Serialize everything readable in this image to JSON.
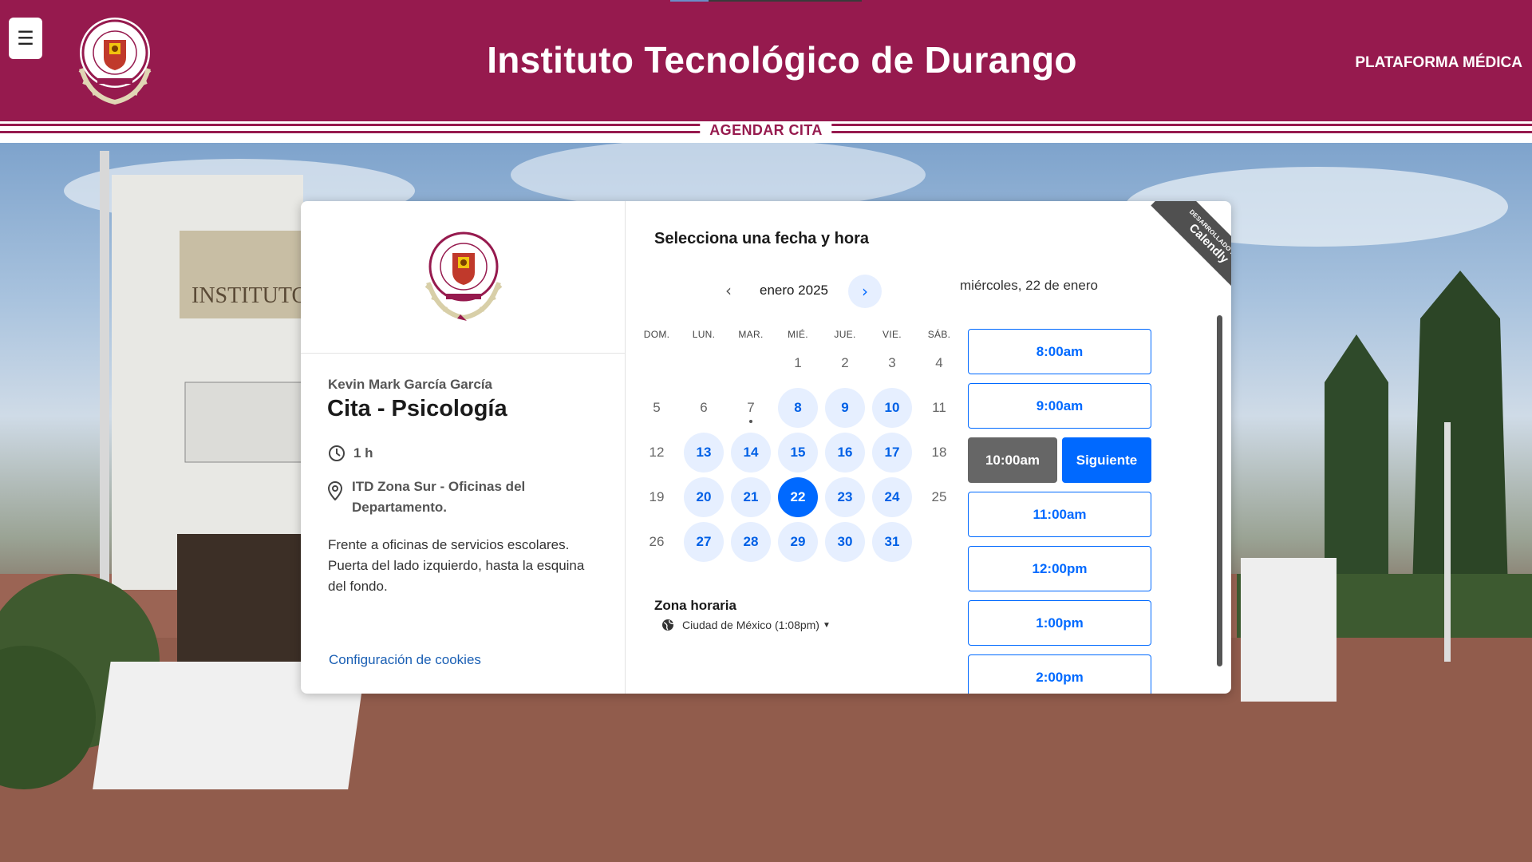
{
  "header": {
    "menu_icon": "☰",
    "title": "Instituto Tecnológico de Durango",
    "platform": "PLATAFORMA MÉDICA"
  },
  "section": {
    "title": "AGENDAR CITA"
  },
  "event": {
    "host": "Kevin Mark García García",
    "title": "Cita - Psicología",
    "duration": "1 h",
    "location": "ITD Zona Sur - Oficinas del Departamento.",
    "description": "Frente a oficinas de servicios escolares. Puerta del lado izquierdo, hasta la esquina del fondo.",
    "cookies_link": "Configuración de cookies"
  },
  "calendar": {
    "heading": "Selecciona una fecha y hora",
    "month": "enero 2025",
    "weekdays": [
      "DOM.",
      "LUN.",
      "MAR.",
      "MIÉ.",
      "JUE.",
      "VIE.",
      "SÁB."
    ],
    "selected_date_label": "miércoles, 22 de enero"
  },
  "timezone": {
    "label": "Zona horaria",
    "value": "Ciudad de México (1:08pm)"
  },
  "slots": {
    "times": [
      "8:00am",
      "9:00am",
      "10:00am",
      "11:00am",
      "12:00pm",
      "1:00pm",
      "2:00pm"
    ],
    "selected": "10:00am",
    "next_label": "Siguiente"
  },
  "badge": {
    "small": "DESARROLLADO POR",
    "brand": "Calendly"
  },
  "colors": {
    "brand": "#961a4e",
    "accent": "#0069ff",
    "available_day_bg": "#e6efff"
  },
  "icons": {
    "prev": "chevron-left-icon",
    "next": "chevron-right-icon",
    "clock": "clock-icon",
    "location": "map-pin-icon",
    "globe": "globe-icon"
  }
}
